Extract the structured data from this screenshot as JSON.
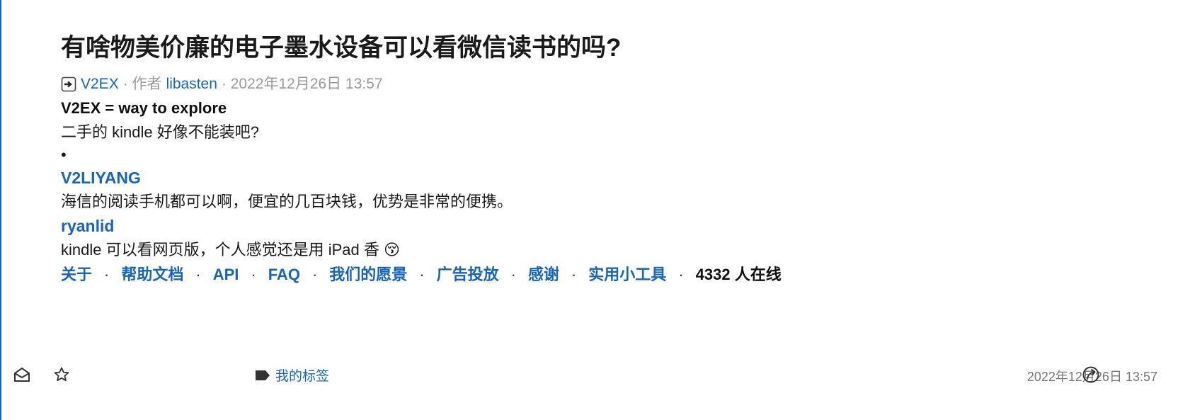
{
  "article": {
    "title": "有啥物美价廉的电子墨水设备可以看微信读书的吗?",
    "source": "V2EX",
    "author_prefix": "· 作者",
    "author": "libasten",
    "date": "· 2022年12月26日 13:57",
    "tagline": "V2EX = way to explore",
    "body": "二手的 kindle 好像不能装吧?",
    "bullet": "•",
    "replies": [
      {
        "user": "V2LIYANG",
        "text": "海信的阅读手机都可以啊，便宜的几百块钱，优势是非常的便携。"
      },
      {
        "user": "ryanlid",
        "text": "kindle 可以看网页版，个人感觉还是用 iPad 香 😚"
      }
    ],
    "footer_links": [
      "关于",
      "帮助文档",
      "API",
      "FAQ",
      "我们的愿景",
      "广告投放",
      "感谢",
      "实用小工具"
    ],
    "separator": "·",
    "online": "4332 人在线"
  },
  "toolbar": {
    "tag_label": "我的标签",
    "timestamp": "2022年12月26日 13:57",
    "icons": [
      "mark-read-icon",
      "star-icon",
      "tag-icon",
      "open-link-icon"
    ]
  },
  "colors": {
    "accent": "#1565c0",
    "meta_gray": "#9a9a9a"
  }
}
